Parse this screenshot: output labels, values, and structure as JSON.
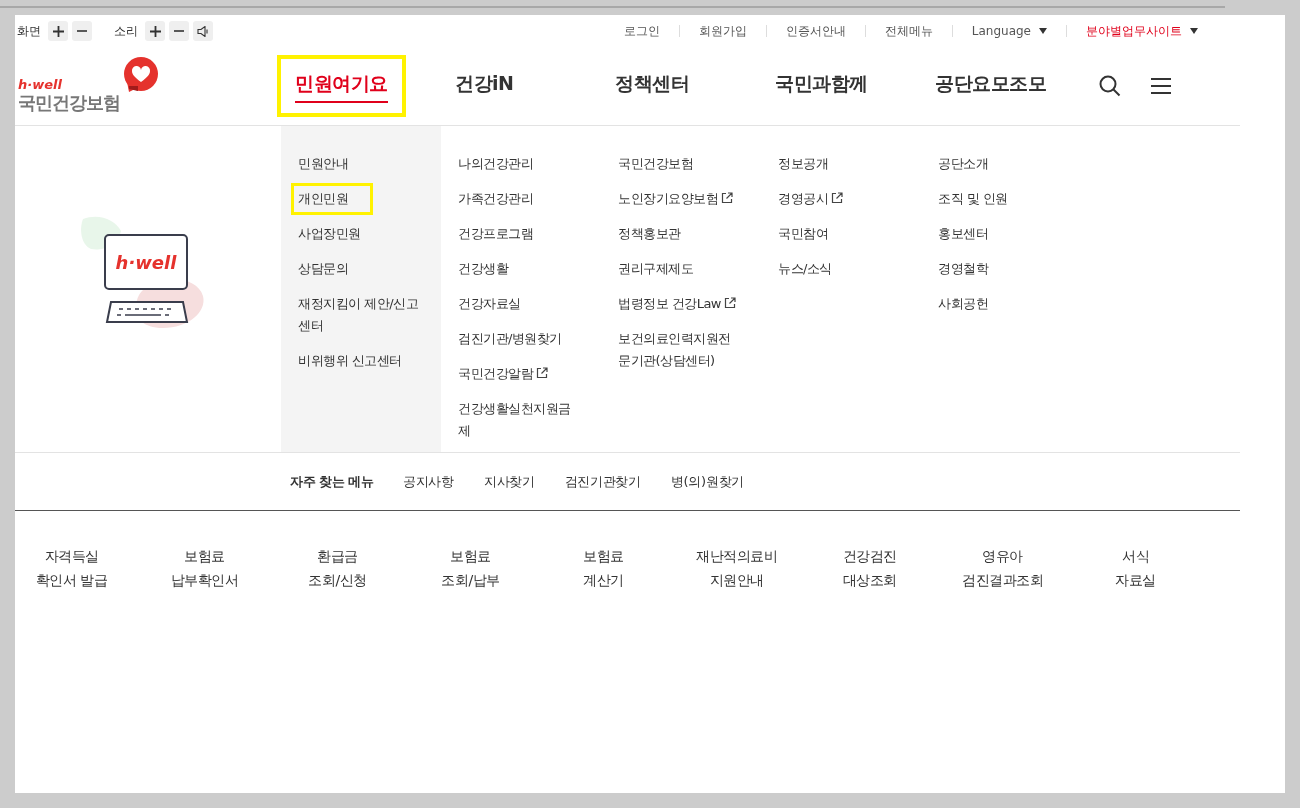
{
  "top_bar": {
    "screen_label": "화면",
    "sound_label": "소리",
    "links": [
      {
        "label": "로그인",
        "kind": "link",
        "emphasized": false
      },
      {
        "label": "회원가입",
        "kind": "link",
        "emphasized": false
      },
      {
        "label": "인증서안내",
        "kind": "link",
        "emphasized": false
      },
      {
        "label": "전체메뉴",
        "kind": "link",
        "emphasized": false
      },
      {
        "label": "Language",
        "kind": "dropdown",
        "emphasized": false
      },
      {
        "label": "분야별업무사이트",
        "kind": "dropdown",
        "emphasized": true
      }
    ]
  },
  "logo": {
    "tagline": "h·well",
    "name": "국민건강보험"
  },
  "nav": [
    {
      "label": "민원여기요",
      "selected": true,
      "highlighted": true
    },
    {
      "label": "건강iN",
      "selected": false,
      "highlighted": false
    },
    {
      "label": "정책센터",
      "selected": false,
      "highlighted": false
    },
    {
      "label": "국민과함께",
      "selected": false,
      "highlighted": false
    },
    {
      "label": "공단요모조모",
      "selected": false,
      "highlighted": false
    }
  ],
  "illustration": {
    "screen_text": "h·well"
  },
  "menu_columns": [
    {
      "items": [
        {
          "label": "민원안내",
          "external": false,
          "highlighted": false
        },
        {
          "label": "개인민원",
          "external": false,
          "highlighted": true
        },
        {
          "label": "사업장민원",
          "external": false,
          "highlighted": false
        },
        {
          "label": "상담문의",
          "external": false,
          "highlighted": false
        },
        {
          "label": "재정지킴이 제안/신고센터",
          "external": false,
          "highlighted": false
        },
        {
          "label": "비위행위 신고센터",
          "external": false,
          "highlighted": false
        }
      ]
    },
    {
      "items": [
        {
          "label": "나의건강관리",
          "external": false,
          "highlighted": false
        },
        {
          "label": "가족건강관리",
          "external": false,
          "highlighted": false
        },
        {
          "label": "건강프로그램",
          "external": false,
          "highlighted": false
        },
        {
          "label": "건강생활",
          "external": false,
          "highlighted": false
        },
        {
          "label": "건강자료실",
          "external": false,
          "highlighted": false
        },
        {
          "label": "검진기관/병원찾기",
          "external": false,
          "highlighted": false
        },
        {
          "label": "국민건강알람",
          "external": true,
          "highlighted": false
        },
        {
          "label": "건강생활실천지원금제",
          "external": false,
          "highlighted": false
        }
      ]
    },
    {
      "items": [
        {
          "label": "국민건강보험",
          "external": false,
          "highlighted": false
        },
        {
          "label": "노인장기요양보험",
          "external": true,
          "highlighted": false
        },
        {
          "label": "정책홍보관",
          "external": false,
          "highlighted": false
        },
        {
          "label": "권리구제제도",
          "external": false,
          "highlighted": false
        },
        {
          "label": "법령정보 건강Law",
          "external": true,
          "highlighted": false
        },
        {
          "label": "보건의료인력지원전문기관(상담센터)",
          "external": false,
          "highlighted": false
        }
      ]
    },
    {
      "items": [
        {
          "label": "정보공개",
          "external": false,
          "highlighted": false
        },
        {
          "label": "경영공시",
          "external": true,
          "highlighted": false
        },
        {
          "label": "국민참여",
          "external": false,
          "highlighted": false
        },
        {
          "label": "뉴스/소식",
          "external": false,
          "highlighted": false
        }
      ]
    },
    {
      "items": [
        {
          "label": "공단소개",
          "external": false,
          "highlighted": false
        },
        {
          "label": "조직 및 인원",
          "external": false,
          "highlighted": false
        },
        {
          "label": "홍보센터",
          "external": false,
          "highlighted": false
        },
        {
          "label": "경영철학",
          "external": false,
          "highlighted": false
        },
        {
          "label": "사회공헌",
          "external": false,
          "highlighted": false
        }
      ]
    }
  ],
  "quick_menu": {
    "title": "자주 찾는 메뉴",
    "links": [
      "공지사항",
      "지사찾기",
      "검진기관찾기",
      "병(의)원찾기"
    ]
  },
  "services": [
    {
      "line1": "자격득실",
      "line2": "확인서 발급"
    },
    {
      "line1": "보험료",
      "line2": "납부확인서"
    },
    {
      "line1": "환급금",
      "line2": "조회/신청"
    },
    {
      "line1": "보험료",
      "line2": "조회/납부"
    },
    {
      "line1": "보험료",
      "line2": "계산기"
    },
    {
      "line1": "재난적의료비",
      "line2": "지원안내"
    },
    {
      "line1": "건강검진",
      "line2": "대상조회"
    },
    {
      "line1": "영유아",
      "line2": "검진결과조회"
    },
    {
      "line1": "서식",
      "line2": "자료실"
    }
  ]
}
